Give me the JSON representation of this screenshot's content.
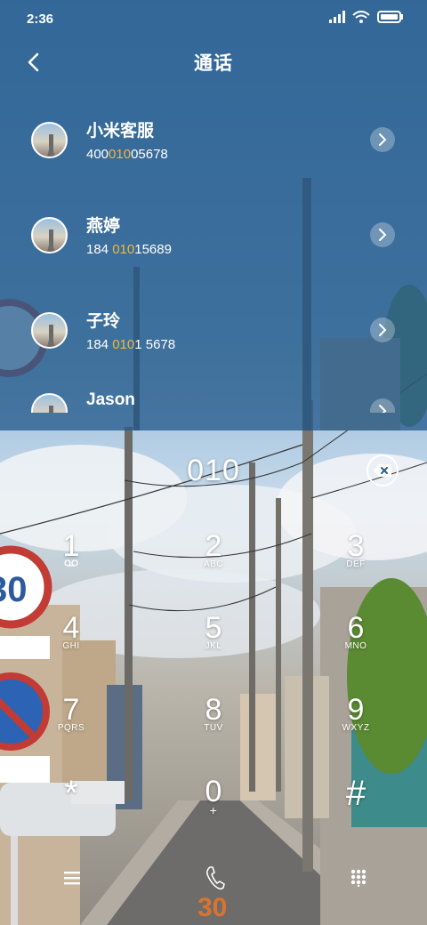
{
  "status_bar": {
    "time": "2:36"
  },
  "header": {
    "title": "通话"
  },
  "contacts": [
    {
      "name": "小米客服",
      "number_pre": "400",
      "number_match": "010",
      "number_post": "05678"
    },
    {
      "name": "燕婷",
      "number_pre": "184 ",
      "number_match": "010",
      "number_post": "15689"
    },
    {
      "name": "子玲",
      "number_pre": "184 ",
      "number_match": "010",
      "number_post": "1 5678"
    },
    {
      "name": "Jason",
      "number_pre": "",
      "number_match": "",
      "number_post": ""
    }
  ],
  "dialer": {
    "input": "010"
  },
  "keypad": [
    {
      "digit": "1",
      "letters": "voicemail-icon"
    },
    {
      "digit": "2",
      "letters": "ABC"
    },
    {
      "digit": "3",
      "letters": "DEF"
    },
    {
      "digit": "4",
      "letters": "GHI"
    },
    {
      "digit": "5",
      "letters": "JKL"
    },
    {
      "digit": "6",
      "letters": "MNO"
    },
    {
      "digit": "7",
      "letters": "PQRS"
    },
    {
      "digit": "8",
      "letters": "TUV"
    },
    {
      "digit": "9",
      "letters": "WXYZ"
    },
    {
      "digit": "*",
      "letters": ""
    },
    {
      "digit": "0",
      "letters": "+"
    },
    {
      "digit": "#",
      "letters": ""
    }
  ],
  "colors": {
    "match_highlight": "#f3b73b",
    "header_overlay": "#265c8c"
  }
}
